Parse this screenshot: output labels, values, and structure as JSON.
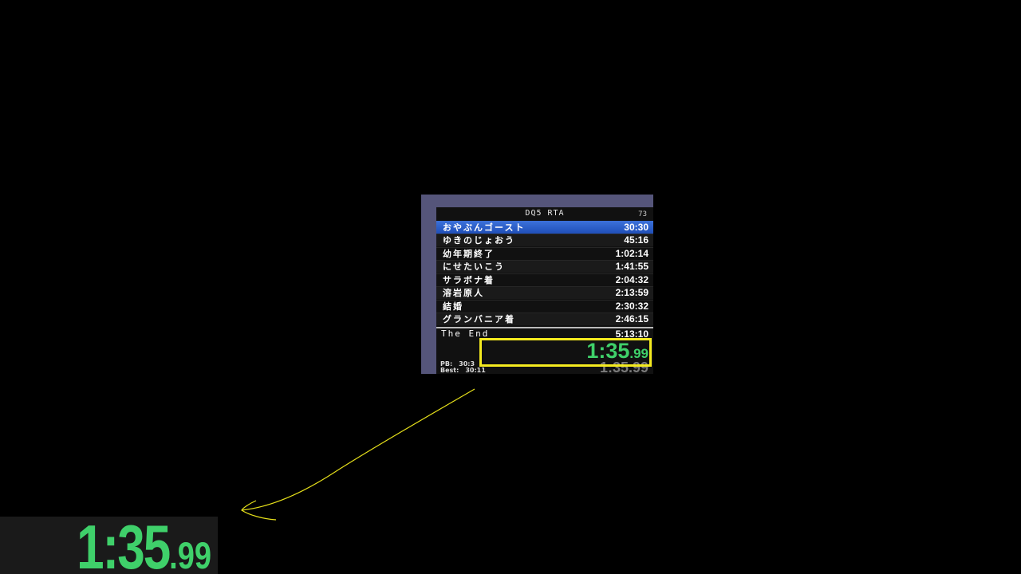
{
  "splits": {
    "title": "DQ5 RTA",
    "attempt_count": "73",
    "segments": [
      {
        "name": "おやぶんゴースト",
        "time": "30:30"
      },
      {
        "name": "ゆきのじょおう",
        "time": "45:16"
      },
      {
        "name": "幼年期終了",
        "time": "1:02:14"
      },
      {
        "name": "にせたいこう",
        "time": "1:41:55"
      },
      {
        "name": "サラボナ着",
        "time": "2:04:32"
      },
      {
        "name": "溶岩原人",
        "time": "2:13:59"
      },
      {
        "name": "結婚",
        "time": "2:30:32"
      },
      {
        "name": "グランバニア着",
        "time": "2:46:15"
      }
    ],
    "final_split": {
      "name": "The End",
      "time": "5:13:10"
    },
    "timer": {
      "main": "1:35",
      "fraction": ".99"
    },
    "segment_timer": "1:35.99",
    "pb": {
      "label": "PB:",
      "value": "30:3"
    },
    "best": {
      "label": "Best:",
      "value": "30:11"
    }
  },
  "zoom": {
    "main": "1:35",
    "fraction": ".99"
  },
  "colors": {
    "timer_green": "#3fd06a",
    "highlight_yellow": "#f4ea1f",
    "current_split_blue": "#2a5cc8",
    "window_frame": "#55557a"
  }
}
